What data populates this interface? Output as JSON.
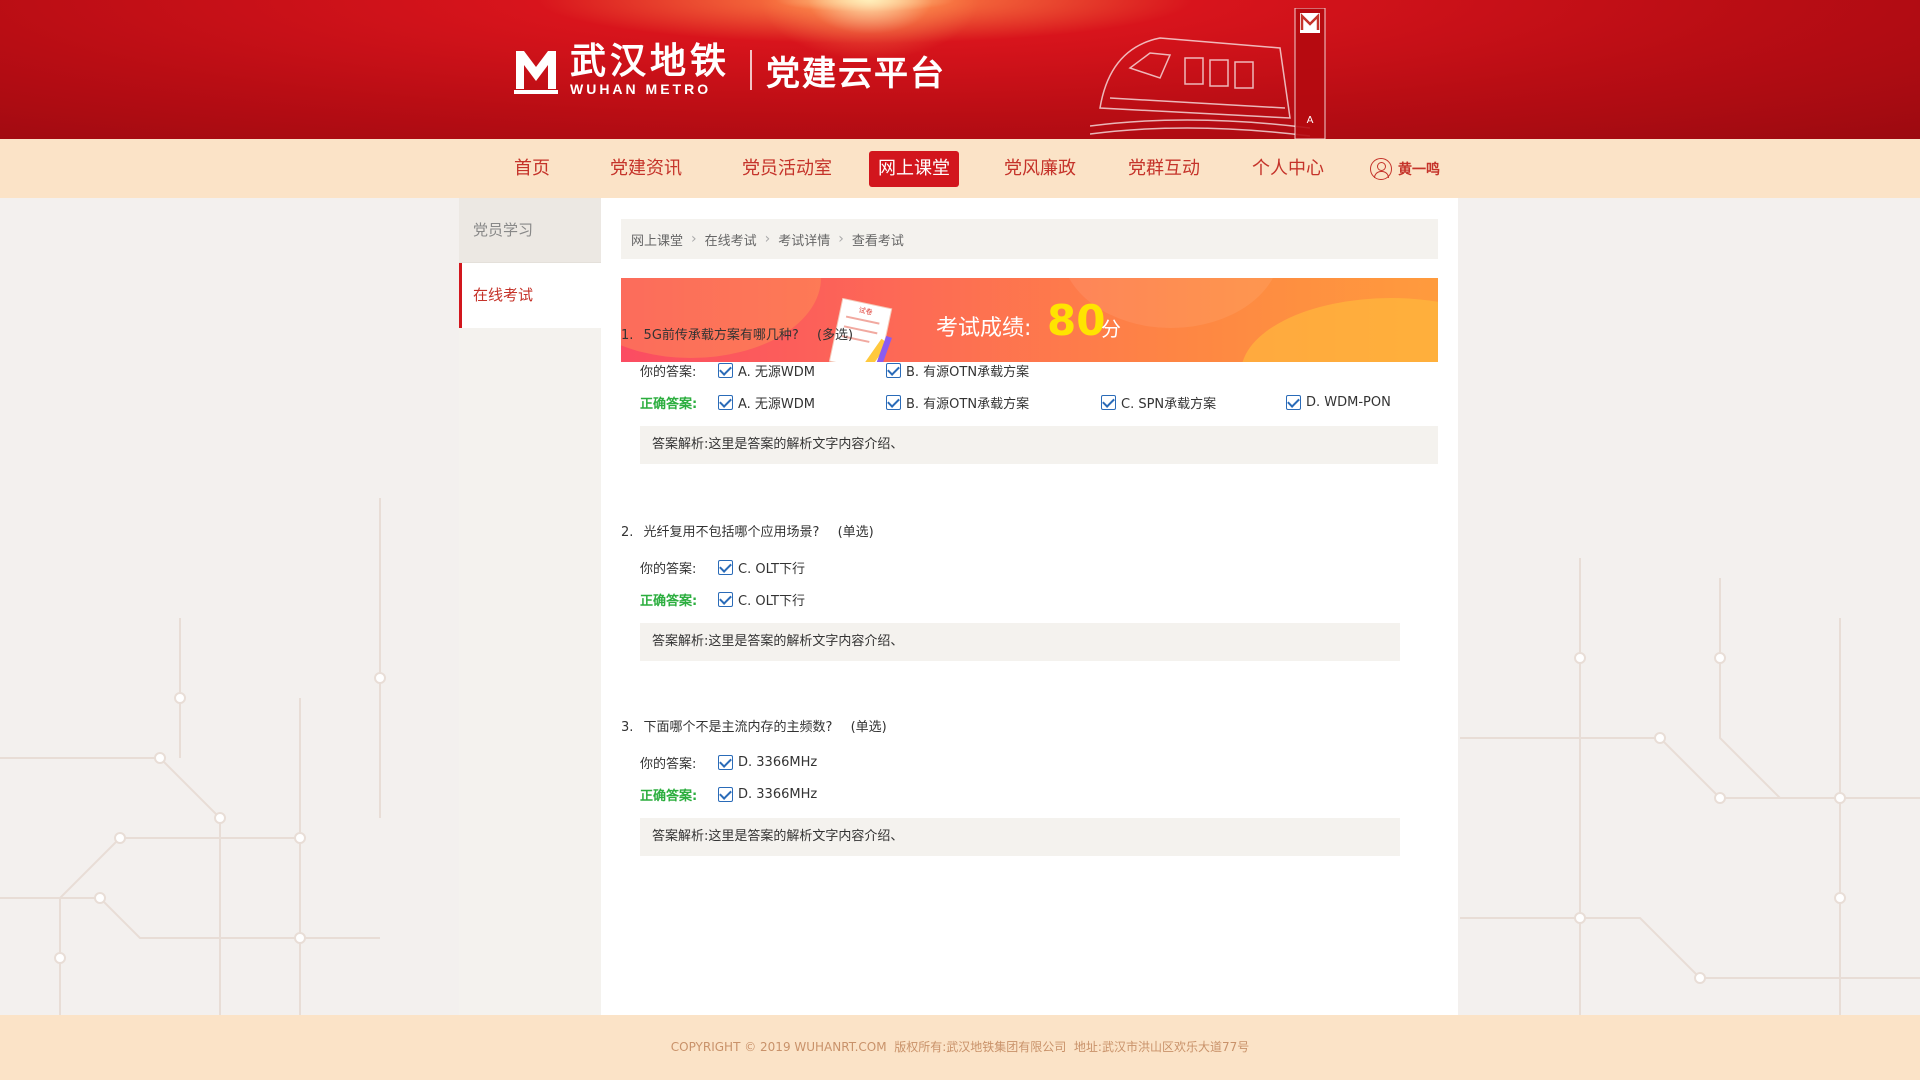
{
  "header": {
    "brand_cn": "武汉地铁",
    "brand_en": "WUHAN METRO",
    "platform": "党建云平台"
  },
  "nav": {
    "items": [
      {
        "label": "首页"
      },
      {
        "label": "党建资讯"
      },
      {
        "label": "党员活动室"
      },
      {
        "label": "网上课堂",
        "active": true
      },
      {
        "label": "党风廉政"
      },
      {
        "label": "党群互动"
      },
      {
        "label": "个人中心"
      }
    ],
    "user_name": "黄一鸣"
  },
  "sidebar": {
    "items": [
      {
        "label": "党员学习"
      },
      {
        "label": "在线考试",
        "active": true
      }
    ]
  },
  "breadcrumb": [
    "网上课堂",
    "在线考试",
    "考试详情",
    "查看考试"
  ],
  "score": {
    "label": "考试成绩:",
    "value": "80",
    "unit": "分",
    "paper_stamp": "试卷"
  },
  "labels": {
    "your_answer": "你的答案:",
    "correct_answer": "正确答案:"
  },
  "questions": [
    {
      "number": "1.",
      "text": "5G前传承载方案有哪几种?",
      "type": "(多选)",
      "your_answers": [
        "A. 无源WDM",
        "B. 有源OTN承载方案"
      ],
      "correct_answers": [
        "A. 无源WDM",
        "B. 有源OTN承载方案",
        "C. SPN承载方案",
        "D. WDM-PON"
      ],
      "analysis": "答案解析:这里是答案的解析文字内容介绍、"
    },
    {
      "number": "2.",
      "text": "光纤复用不包括哪个应用场景?",
      "type": "(单选)",
      "your_answers": [
        "C. OLT下行"
      ],
      "correct_answers": [
        "C. OLT下行"
      ],
      "analysis": "答案解析:这里是答案的解析文字内容介绍、"
    },
    {
      "number": "3.",
      "text": "下面哪个不是主流内存的主频数?",
      "type": "(单选)",
      "your_answers": [
        "D. 3366MHz"
      ],
      "correct_answers": [
        "D. 3366MHz"
      ],
      "analysis": "答案解析:这里是答案的解析文字内容介绍、"
    }
  ],
  "footer": {
    "text": "COPYRIGHT © 2019 WUHANRT.COM  版权所有:武汉地铁集团有限公司  地址:武汉市洪山区欢乐大道77号"
  },
  "colors": {
    "brand_red": "#d2161d",
    "nav_bg": "#fbe3c7",
    "correct_green": "#2cae3f",
    "score_yellow": "#ffe400"
  }
}
